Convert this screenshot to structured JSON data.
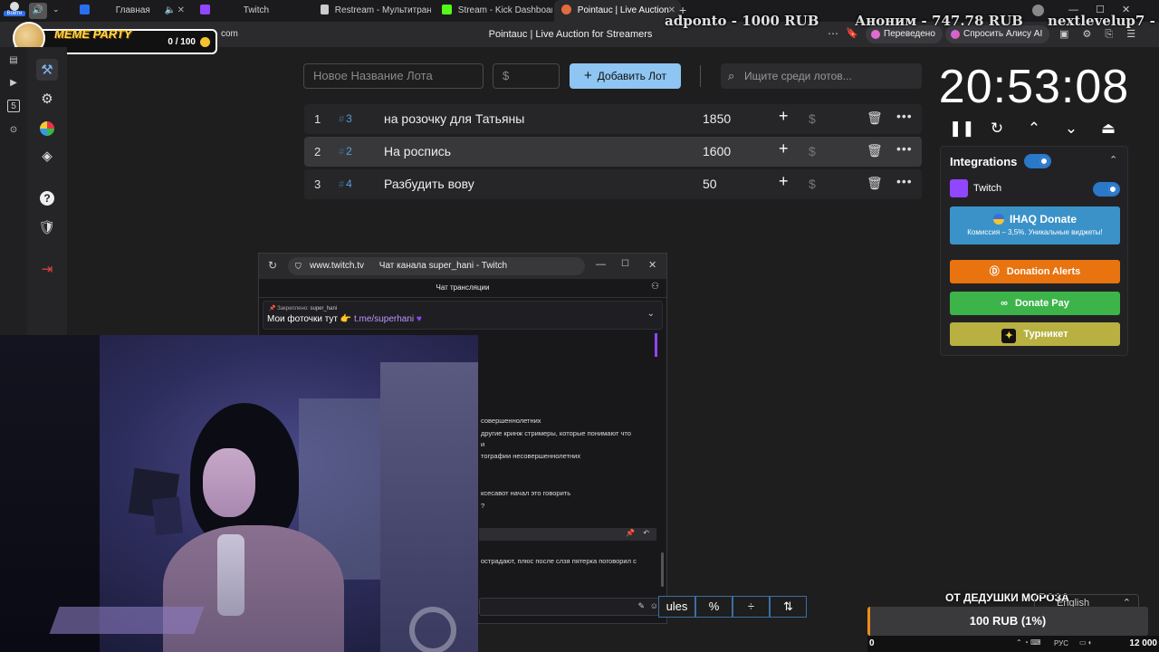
{
  "browser": {
    "login_label": "Войти",
    "tabs": [
      {
        "label": "Главная",
        "icon": "video-icon",
        "color": "#2a6ef0"
      },
      {
        "label": "Twitch",
        "icon": "twitch-icon",
        "color": "#9146ff"
      },
      {
        "label": "Restream - Мультитрансл",
        "icon": "document-icon",
        "color": "#cccccc"
      },
      {
        "label": "Stream - Kick Dashboard",
        "icon": "kick-icon",
        "color": "#53fc18"
      },
      {
        "label": "Pointauc | Live Auction",
        "icon": "pointauc-icon",
        "color": "#e46b3c"
      }
    ],
    "url_fragment": "com",
    "page_title": "Pointauc | Live Auction for Streamers",
    "translated_label": "Переведено",
    "ask_alice_label": "Спросить Алису AI"
  },
  "overlay": {
    "donations": [
      "adponto - 1000 RUB",
      "Аноним - 747.78 RUB",
      "nextlevelup7 -"
    ],
    "meme_party": {
      "label": "MEME PARTY",
      "score": "0 / 100"
    }
  },
  "lot_form": {
    "name_placeholder": "Новое Название Лота",
    "amount_placeholder": "$",
    "add_label": "Добавить Лот",
    "search_placeholder": "Ищите среди лотов..."
  },
  "lots": [
    {
      "rank": "1",
      "id": "3",
      "name": "на розочку для Татьяны",
      "amount": "1850"
    },
    {
      "rank": "2",
      "id": "2",
      "name": "На роспись",
      "amount": "1600"
    },
    {
      "rank": "3",
      "id": "4",
      "name": "Разбудить вову",
      "amount": "50"
    }
  ],
  "timer": {
    "value": "20:53:08"
  },
  "integrations": {
    "title": "Integrations",
    "twitch_label": "Twitch",
    "ihaq": {
      "label": "IHAQ Donate",
      "sub": "Комиссия – 3,5%. Уникальные виджеты!",
      "color": "#3a92c8"
    },
    "donation_alerts": {
      "label": "Donation Alerts",
      "color": "#e8730f"
    },
    "donate_pay": {
      "label": "Donate Pay",
      "color": "#3cb44a"
    },
    "turniket": {
      "label": "Турникет",
      "color": "#b8b040"
    }
  },
  "chat_window": {
    "url": "www.twitch.tv",
    "title": "Чат канала super_hani - Twitch",
    "header": "Чат трансляции",
    "pinned_label": "Закреплено:",
    "pinned_user": "super_hani",
    "pinned_text": "Мои фоточки тут 👉",
    "pinned_link": "t.me/superhani",
    "lines": [
      "совершеннолетних",
      "другие кринж стримеры, которые понимают что",
      "и",
      "тографии несовершеннолетних",
      "ксесавот начал это говорить",
      "?",
      "острадают, плюс после слзя пятерка поговорил с"
    ]
  },
  "tools": {
    "rules_fragment": "ules",
    "percent": "%",
    "split": "÷",
    "sort": "⇅"
  },
  "footer": {
    "caption": "ОТ ДЕДУШКИ МОРОЗА",
    "language": "English",
    "goal_text": "100 RUB (1%)",
    "goal_start": "0",
    "goal_end": "12 000",
    "goal_percent": 1,
    "taskbar_lang": "РУС"
  }
}
